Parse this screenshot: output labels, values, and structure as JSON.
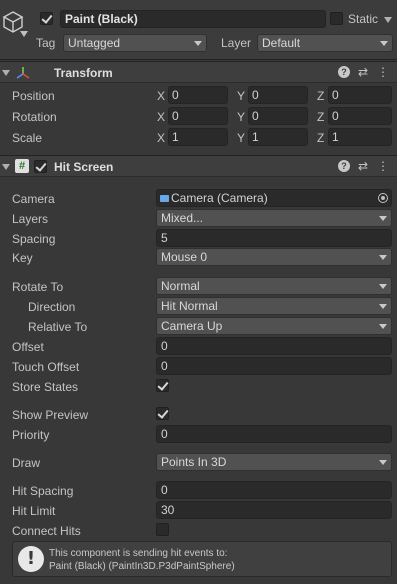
{
  "object": {
    "name": "Paint (Black)",
    "static_label": "Static",
    "tag_label": "Tag",
    "tag_value": "Untagged",
    "layer_label": "Layer",
    "layer_value": "Default"
  },
  "transform": {
    "title": "Transform",
    "rows": [
      {
        "label": "Position",
        "x": "0",
        "y": "0",
        "z": "0"
      },
      {
        "label": "Rotation",
        "x": "0",
        "y": "0",
        "z": "0"
      },
      {
        "label": "Scale",
        "x": "1",
        "y": "1",
        "z": "1"
      }
    ],
    "axis_x": "X",
    "axis_y": "Y",
    "axis_z": "Z"
  },
  "hit_screen": {
    "title": "Hit Screen",
    "camera_label": "Camera",
    "camera_value": "Camera (Camera)",
    "layers_label": "Layers",
    "layers_value": "Mixed...",
    "spacing_label": "Spacing",
    "spacing_value": "5",
    "key_label": "Key",
    "key_value": "Mouse 0",
    "rotate_to_label": "Rotate To",
    "rotate_to_value": "Normal",
    "direction_label": "Direction",
    "direction_value": "Hit Normal",
    "relative_to_label": "Relative To",
    "relative_to_value": "Camera Up",
    "offset_label": "Offset",
    "offset_value": "0",
    "touch_offset_label": "Touch Offset",
    "touch_offset_value": "0",
    "store_states_label": "Store States",
    "store_states_checked": true,
    "show_preview_label": "Show Preview",
    "show_preview_checked": true,
    "priority_label": "Priority",
    "priority_value": "0",
    "draw_label": "Draw",
    "draw_value": "Points In 3D",
    "hit_spacing_label": "Hit Spacing",
    "hit_spacing_value": "0",
    "hit_limit_label": "Hit Limit",
    "hit_limit_value": "30",
    "connect_hits_label": "Connect Hits",
    "connect_hits_checked": false,
    "info_line1": "This component is sending hit events to:",
    "info_line2": "Paint (Black) (PaintIn3D.P3dPaintSphere)"
  },
  "colors": {
    "background": "#383838",
    "header": "#3e3e3e",
    "field": "#2a2a2a",
    "dropdown": "#515151"
  }
}
